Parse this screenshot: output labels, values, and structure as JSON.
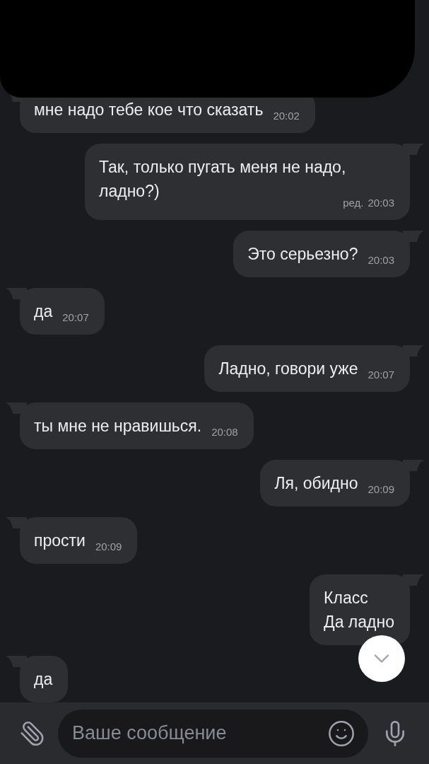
{
  "messages": [
    {
      "kind": "incoming",
      "text": "мне надо тебе кое что сказать",
      "time": "20:02"
    },
    {
      "kind": "outgoing",
      "text": "Так, только пугать меня не надо, ладно?)",
      "edited_label": "ред.",
      "time": "20:03"
    },
    {
      "kind": "outgoing",
      "text": "Это серьезно?",
      "time": "20:03"
    },
    {
      "kind": "incoming",
      "text": "да",
      "time": "20:07"
    },
    {
      "kind": "outgoing",
      "text": "Ладно, говори уже",
      "time": "20:07"
    },
    {
      "kind": "incoming",
      "text": "ты мне не нравишься.",
      "time": "20:08"
    },
    {
      "kind": "outgoing",
      "text": "Ля, обидно",
      "time": "20:09"
    },
    {
      "kind": "incoming",
      "text": "прости",
      "time": "20:09"
    },
    {
      "kind": "outgoing",
      "text": "Класс\nДа ладно"
    },
    {
      "kind": "incoming",
      "text": "да"
    }
  ],
  "composer": {
    "placeholder": "Ваше сообщение"
  }
}
